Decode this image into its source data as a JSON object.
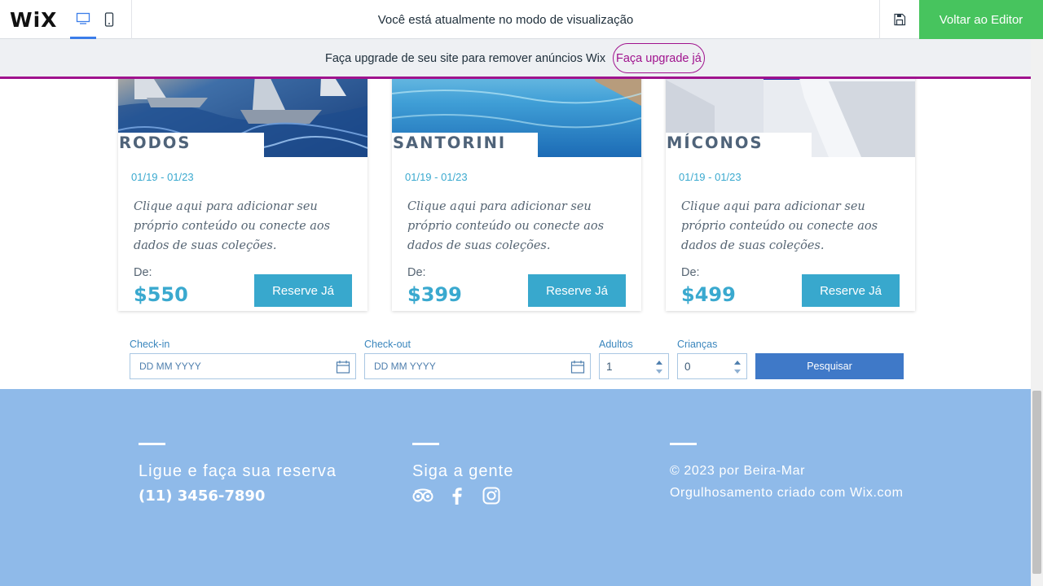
{
  "topbar": {
    "logo": "WiX",
    "preview_message": "Você está atualmente no modo de visualização",
    "back_to_editor": "Voltar ao Editor"
  },
  "banner": {
    "text": "Faça upgrade de seu site para remover anúncios Wix",
    "link": "Faça upgrade já",
    "accent_color": "#a0138e"
  },
  "cards": [
    {
      "title": "RODOS",
      "dates": "01/19 - 01/23",
      "description": "Clique aqui para adicionar seu próprio conteúdo ou conecte aos dados de suas coleções.",
      "from_label": "De:",
      "price": "$550",
      "button": "Reserve Já"
    },
    {
      "title": "SANTORINI",
      "dates": "01/19 - 01/23",
      "description": "Clique aqui para adicionar seu próprio conteúdo ou conecte aos dados de suas coleções.",
      "from_label": "De:",
      "price": "$399",
      "button": "Reserve Já"
    },
    {
      "title": "MÍCONOS",
      "dates": "01/19 - 01/23",
      "description": "Clique aqui para adicionar seu próprio conteúdo ou conecte aos dados de suas coleções.",
      "from_label": "De:",
      "price": "$499",
      "button": "Reserve Já"
    }
  ],
  "booking": {
    "checkin_label": "Check-in",
    "checkin_placeholder": "DD MM YYYY",
    "checkout_label": "Check-out",
    "checkout_placeholder": "DD MM YYYY",
    "adults_label": "Adultos",
    "adults_value": "1",
    "children_label": "Crianças",
    "children_value": "0",
    "search_button": "Pesquisar"
  },
  "footer": {
    "contact_heading": "Ligue e faça sua reserva",
    "phone": "(11) 3456-7890",
    "follow_heading": "Siga a gente",
    "social_icons": [
      "tripadvisor-icon",
      "facebook-icon",
      "instagram-icon"
    ],
    "copyright": "© 2023 por Beira-Mar",
    "credit": "Orgulhosamento criado com Wix.com",
    "background_color": "#8fbae9"
  }
}
